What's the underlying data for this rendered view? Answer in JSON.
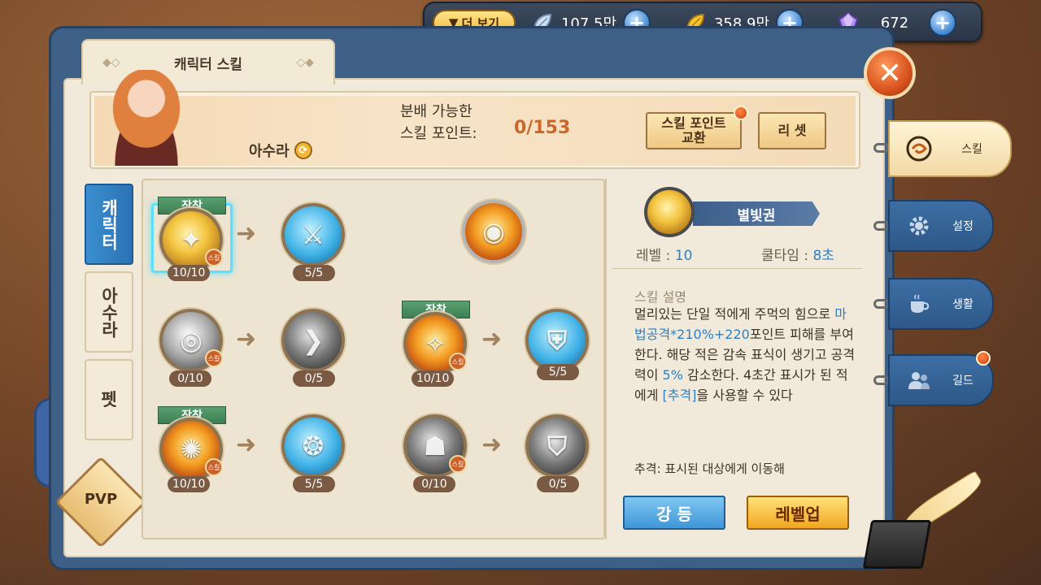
{
  "topbar": {
    "more_label": "더 보기",
    "currencies": [
      {
        "icon": "silver-leaf-icon",
        "value": "107.5만"
      },
      {
        "icon": "gold-leaf-icon",
        "value": "358.9만"
      },
      {
        "icon": "crystal-gem-icon",
        "value": "672"
      }
    ],
    "plus_label": "+"
  },
  "window": {
    "title": "캐릭터 스킬"
  },
  "header": {
    "character_name": "아수라",
    "points_label_line1": "분배 가능한",
    "points_label_line2": "스킬 포인트:",
    "points_value": "0/153",
    "exchange_button": "스킬 포인트 교환",
    "reset_button": "리 셋"
  },
  "left_tabs": {
    "character": "캐릭터",
    "asura": "아수라",
    "pet": "펫",
    "pvp": "PVP"
  },
  "skills": {
    "equip_label": "장착",
    "badge_label": "스킬",
    "arrow": "➜",
    "levels": [
      "10/10",
      "5/5",
      "0/10",
      "0/5",
      "10/10",
      "5/5",
      "10/10",
      "5/5",
      "0/10",
      "0/5"
    ]
  },
  "detail": {
    "name": "별빛권",
    "level_label": "레벨 : ",
    "level_value": "10",
    "cooldown_label": "쿨타임 : ",
    "cooldown_value": "8초",
    "desc_title": "스킬 설명",
    "desc_1": "멀리있는 단일 적에게 주먹의 힘으로",
    "desc_formula": "마법공격*210%+220",
    "desc_2": "포인트 피해를 부여한다. 해당 적은 감속 표식이 생기고 공격력이 ",
    "desc_pct": "5%",
    "desc_3": " 감소한다. 4초간 표시가 된 적에게 ",
    "desc_skill": "[추격]",
    "desc_4": "을 사용할 수 있다",
    "extra": "추격: 표시된 대상에게 이동해",
    "enhance_button": "강 등",
    "levelup_button": "레벨업"
  },
  "right_tabs": {
    "skill": "스킬",
    "settings": "설정",
    "life": "생활",
    "guild": "길드"
  },
  "close_label": "✕",
  "colors": {
    "accent_blue": "#2f7fc0",
    "points_orange": "#c9682a",
    "notify_red": "#d03a08"
  }
}
